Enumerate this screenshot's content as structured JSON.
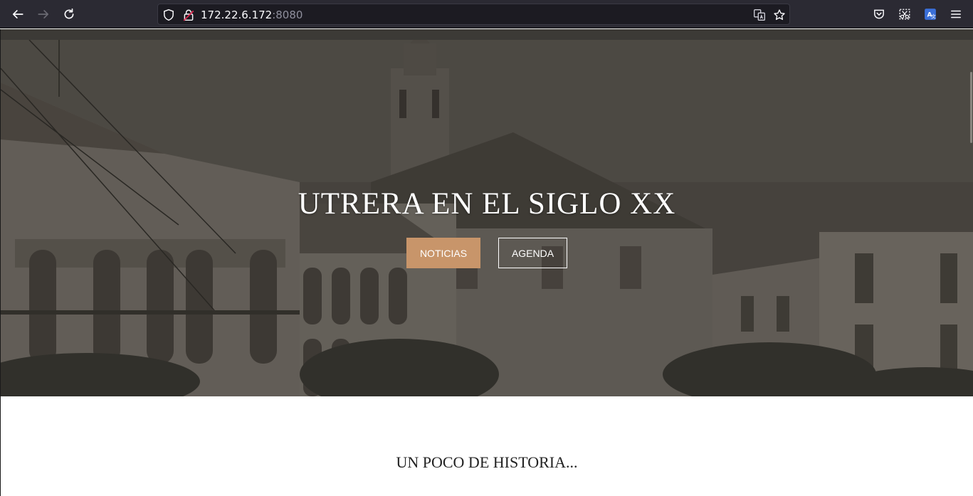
{
  "browser": {
    "url_host": "172.22.6.172",
    "url_port": ":8080",
    "icons": [
      "back-icon",
      "forward-icon",
      "reload-icon",
      "shield-icon",
      "lock-icon",
      "translate-icon",
      "bookmark-star-icon",
      "pocket-icon",
      "screenshot-icon",
      "translate-extension-icon",
      "menu-icon"
    ]
  },
  "hero": {
    "title": "UTRERA EN EL SIGLO XX",
    "buttons": {
      "noticias": "NOTICIAS",
      "agenda": "AGENDA"
    },
    "accent_color": "#c8956a"
  },
  "content": {
    "section_title": "UN POCO DE HISTORIA..."
  }
}
